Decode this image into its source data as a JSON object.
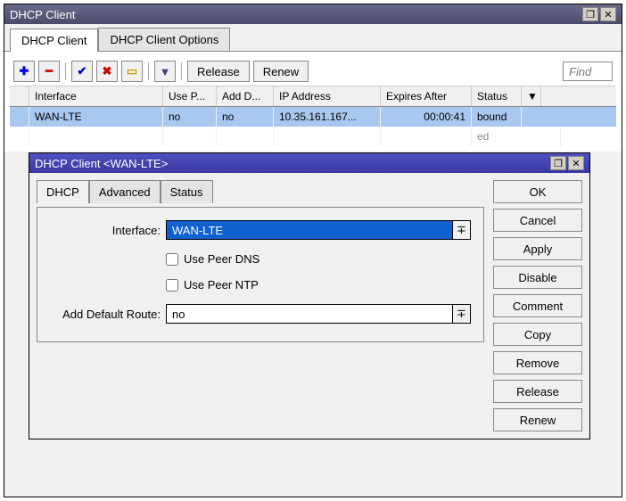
{
  "main": {
    "title": "DHCP Client",
    "tabs": [
      "DHCP Client",
      "DHCP Client Options"
    ],
    "activeTab": 0,
    "toolbar": {
      "release": "Release",
      "renew": "Renew",
      "find_placeholder": "Find"
    },
    "grid": {
      "headers": [
        "",
        "Interface",
        "Use P...",
        "Add D...",
        "IP Address",
        "Expires After",
        "Status"
      ],
      "rows": [
        {
          "flag": "",
          "interface": "WAN-LTE",
          "usep": "no",
          "addd": "no",
          "ip": "10.35.161.167...",
          "exp": "00:00:41",
          "status": "bound",
          "selected": true
        },
        {
          "flag": "",
          "interface": "",
          "usep": "",
          "addd": "",
          "ip": "",
          "exp": "",
          "status": "ed",
          "selected": false,
          "dim": true
        }
      ]
    }
  },
  "dialog": {
    "title": "DHCP Client <WAN-LTE>",
    "tabs": [
      "DHCP",
      "Advanced",
      "Status"
    ],
    "activeTab": 0,
    "form": {
      "interface_label": "Interface:",
      "interface_value": "WAN-LTE",
      "use_peer_dns": "Use Peer DNS",
      "use_peer_ntp": "Use Peer NTP",
      "add_default_route_label": "Add Default Route:",
      "add_default_route_value": "no"
    },
    "buttons": [
      "OK",
      "Cancel",
      "Apply",
      "Disable",
      "Comment",
      "Copy",
      "Remove",
      "Release",
      "Renew"
    ]
  }
}
